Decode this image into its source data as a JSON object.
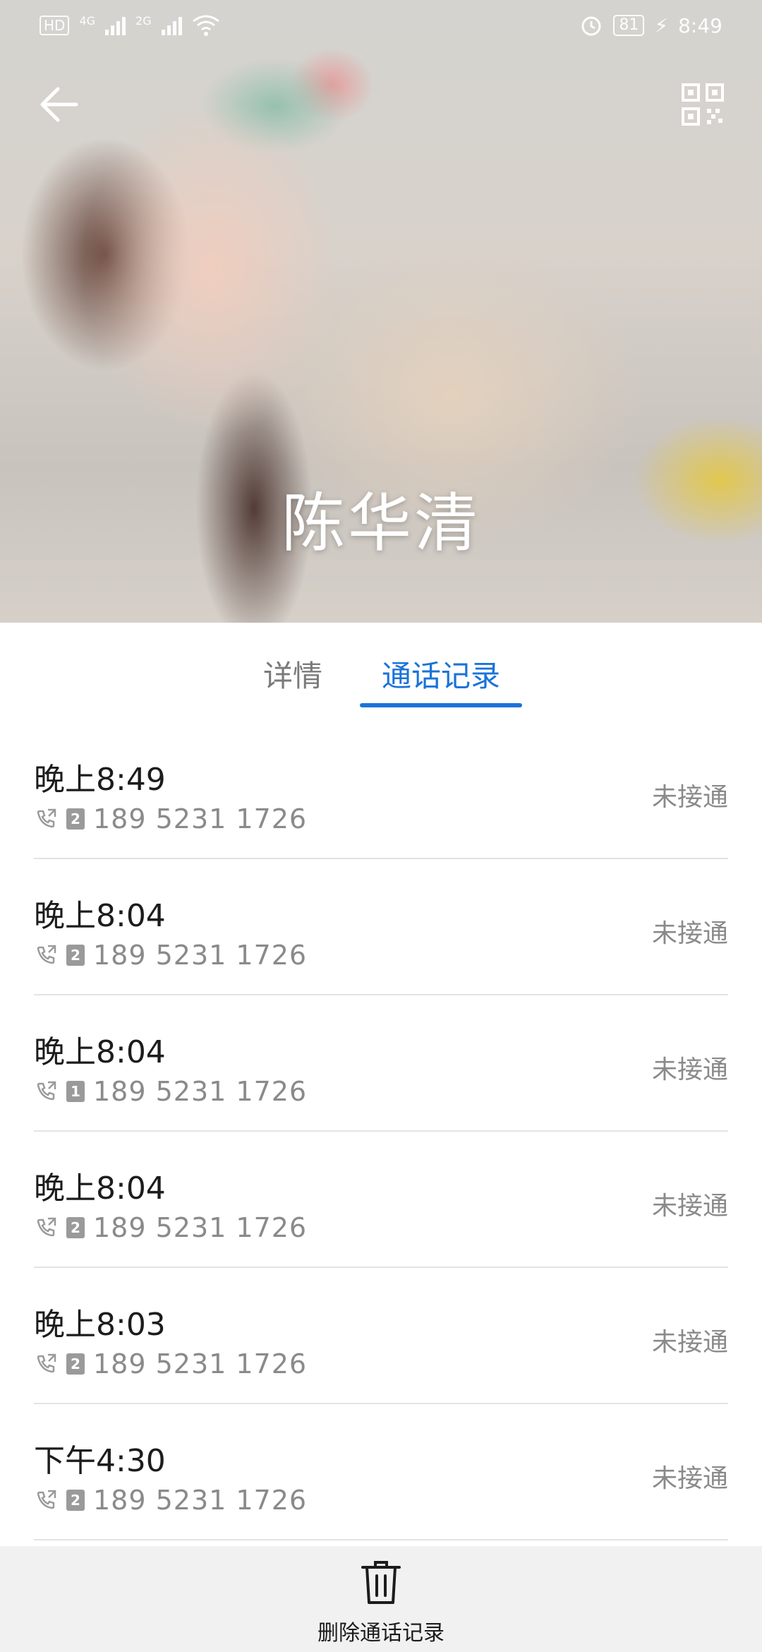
{
  "status_bar": {
    "hd_label": "HD",
    "net1": "4G",
    "net2": "2G",
    "battery": "81",
    "time": "8:49"
  },
  "contact": {
    "name": "陈华清"
  },
  "tabs": [
    {
      "label": "详情",
      "active": false
    },
    {
      "label": "通话记录",
      "active": true
    }
  ],
  "calls": [
    {
      "time": "晚上8:49",
      "sim": "2",
      "number": "189 5231 1726",
      "status": "未接通"
    },
    {
      "time": "晚上8:04",
      "sim": "2",
      "number": "189 5231 1726",
      "status": "未接通"
    },
    {
      "time": "晚上8:04",
      "sim": "1",
      "number": "189 5231 1726",
      "status": "未接通"
    },
    {
      "time": "晚上8:04",
      "sim": "2",
      "number": "189 5231 1726",
      "status": "未接通"
    },
    {
      "time": "晚上8:03",
      "sim": "2",
      "number": "189 5231 1726",
      "status": "未接通"
    },
    {
      "time": "下午4:30",
      "sim": "2",
      "number": "189 5231 1726",
      "status": "未接通"
    }
  ],
  "bottom": {
    "delete_label": "删除通话记录"
  },
  "colors": {
    "accent": "#1a73d9",
    "secondary_text": "#8a8a8a",
    "divider": "#e3e3e3"
  },
  "icons": [
    "back-arrow-icon",
    "qr-code-icon",
    "outgoing-call-icon",
    "sim-badge-icon",
    "trash-icon",
    "alarm-icon",
    "wifi-icon"
  ]
}
